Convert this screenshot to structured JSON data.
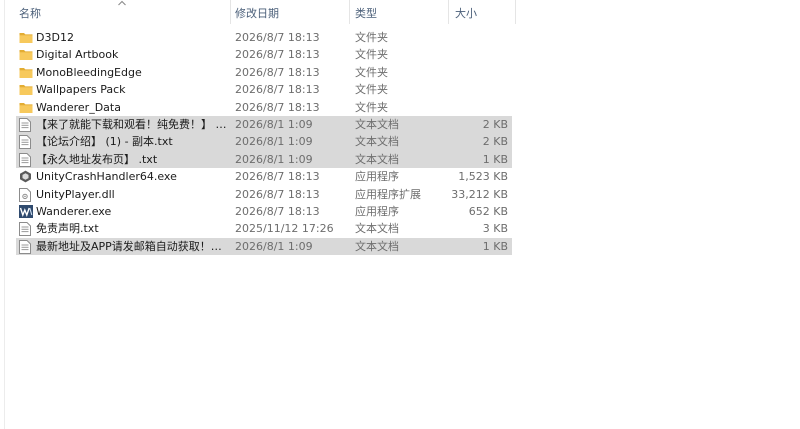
{
  "columns": {
    "name": "名称",
    "modified": "修改日期",
    "type": "类型",
    "size": "大小"
  },
  "colors": {
    "folder": "#f7c95c",
    "folder_dark": "#e3ad33",
    "selection": "#d9d9d9",
    "header_text": "#4c607a"
  },
  "files": [
    {
      "name": "D3D12",
      "date": "2026/8/7 18:13",
      "type": "文件夹",
      "size": "",
      "icon": "folder-icon",
      "selected": false
    },
    {
      "name": "Digital Artbook",
      "date": "2026/8/7 18:13",
      "type": "文件夹",
      "size": "",
      "icon": "folder-icon",
      "selected": false
    },
    {
      "name": "MonoBleedingEdge",
      "date": "2026/8/7 18:13",
      "type": "文件夹",
      "size": "",
      "icon": "folder-icon",
      "selected": false
    },
    {
      "name": "Wallpapers Pack",
      "date": "2026/8/7 18:13",
      "type": "文件夹",
      "size": "",
      "icon": "folder-icon",
      "selected": false
    },
    {
      "name": "Wanderer_Data",
      "date": "2026/8/7 18:13",
      "type": "文件夹",
      "size": "",
      "icon": "folder-icon",
      "selected": false
    },
    {
      "name": "【来了就能下载和观看！纯免费！】 - 副...",
      "date": "2026/8/1 1:09",
      "type": "文本文档",
      "size": "2 KB",
      "icon": "text-file-icon",
      "selected": true
    },
    {
      "name": "【论坛介绍】 (1) - 副本.txt",
      "date": "2026/8/1 1:09",
      "type": "文本文档",
      "size": "2 KB",
      "icon": "text-file-icon",
      "selected": true
    },
    {
      "name": "【永久地址发布页】 .txt",
      "date": "2026/8/1 1:09",
      "type": "文本文档",
      "size": "1 KB",
      "icon": "text-file-icon",
      "selected": true
    },
    {
      "name": "UnityCrashHandler64.exe",
      "date": "2026/8/7 18:13",
      "type": "应用程序",
      "size": "1,523 KB",
      "icon": "unity-exe-icon",
      "selected": false
    },
    {
      "name": "UnityPlayer.dll",
      "date": "2026/8/7 18:13",
      "type": "应用程序扩展",
      "size": "33,212 KB",
      "icon": "dll-file-icon",
      "selected": false
    },
    {
      "name": "Wanderer.exe",
      "date": "2026/8/7 18:13",
      "type": "应用程序",
      "size": "652 KB",
      "icon": "wanderer-exe-icon",
      "selected": false
    },
    {
      "name": "免责声明.txt",
      "date": "2025/11/12 17:26",
      "type": "文本文档",
      "size": "3 KB",
      "icon": "text-file-icon",
      "selected": false
    },
    {
      "name": "最新地址及APP请发邮箱自动获取！！！...",
      "date": "2026/8/1 1:09",
      "type": "文本文档",
      "size": "1 KB",
      "icon": "text-file-icon",
      "selected": true
    }
  ]
}
